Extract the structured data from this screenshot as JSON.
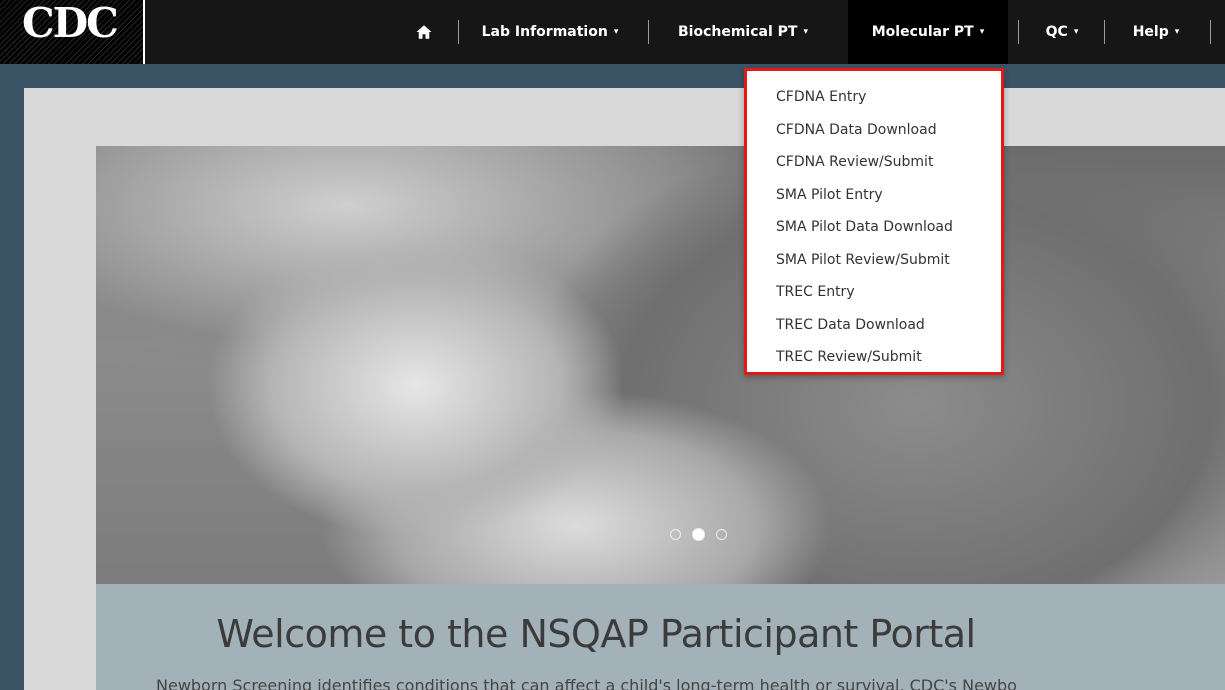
{
  "logo": {
    "text": "CDC"
  },
  "nav": {
    "home_icon": "home-icon",
    "items": [
      {
        "label": "Lab Information",
        "caret": "▾"
      },
      {
        "label": "Biochemical PT",
        "caret": "▾"
      },
      {
        "label": "Molecular PT",
        "caret": "▾"
      },
      {
        "label": "QC",
        "caret": "▾"
      },
      {
        "label": "Help",
        "caret": "▾"
      }
    ]
  },
  "dropdown": {
    "highlight_color": "#e11919",
    "items": [
      "CFDNA Entry",
      "CFDNA Data Download",
      "CFDNA Review/Submit",
      "SMA Pilot Entry",
      "SMA Pilot Data Download",
      "SMA Pilot Review/Submit",
      "TREC Entry",
      "TREC Data Download",
      "TREC Review/Submit"
    ]
  },
  "carousel": {
    "slide_count": 3,
    "active_slide": 2
  },
  "welcome": {
    "title": "Welcome to the NSQAP Participant Portal",
    "intro": "Newborn Screening identifies conditions that can affect a child's long-term health or survival. CDC's Newbo"
  },
  "colors": {
    "navbar": "#161616",
    "page_bg": "#3a5466",
    "panel": "#d9d9d9",
    "band": "#a3b2b9"
  }
}
